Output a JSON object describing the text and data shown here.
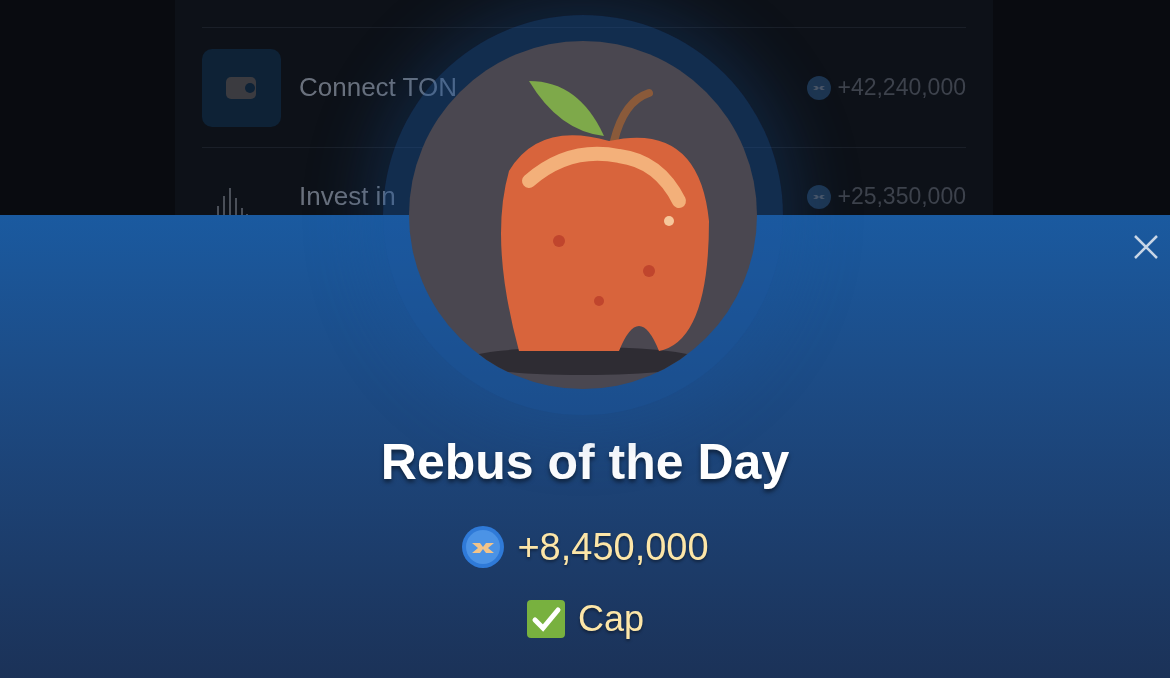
{
  "background_list": [
    {
      "kind": "wallet",
      "title": "Connect TON",
      "reward": "+42,240,000"
    },
    {
      "kind": "chart",
      "title": "Invest in",
      "reward": "+25,350,000"
    }
  ],
  "modal": {
    "title": "Rebus of the Day",
    "reward": "+8,450,000",
    "answer": "Cap",
    "solved": true
  }
}
